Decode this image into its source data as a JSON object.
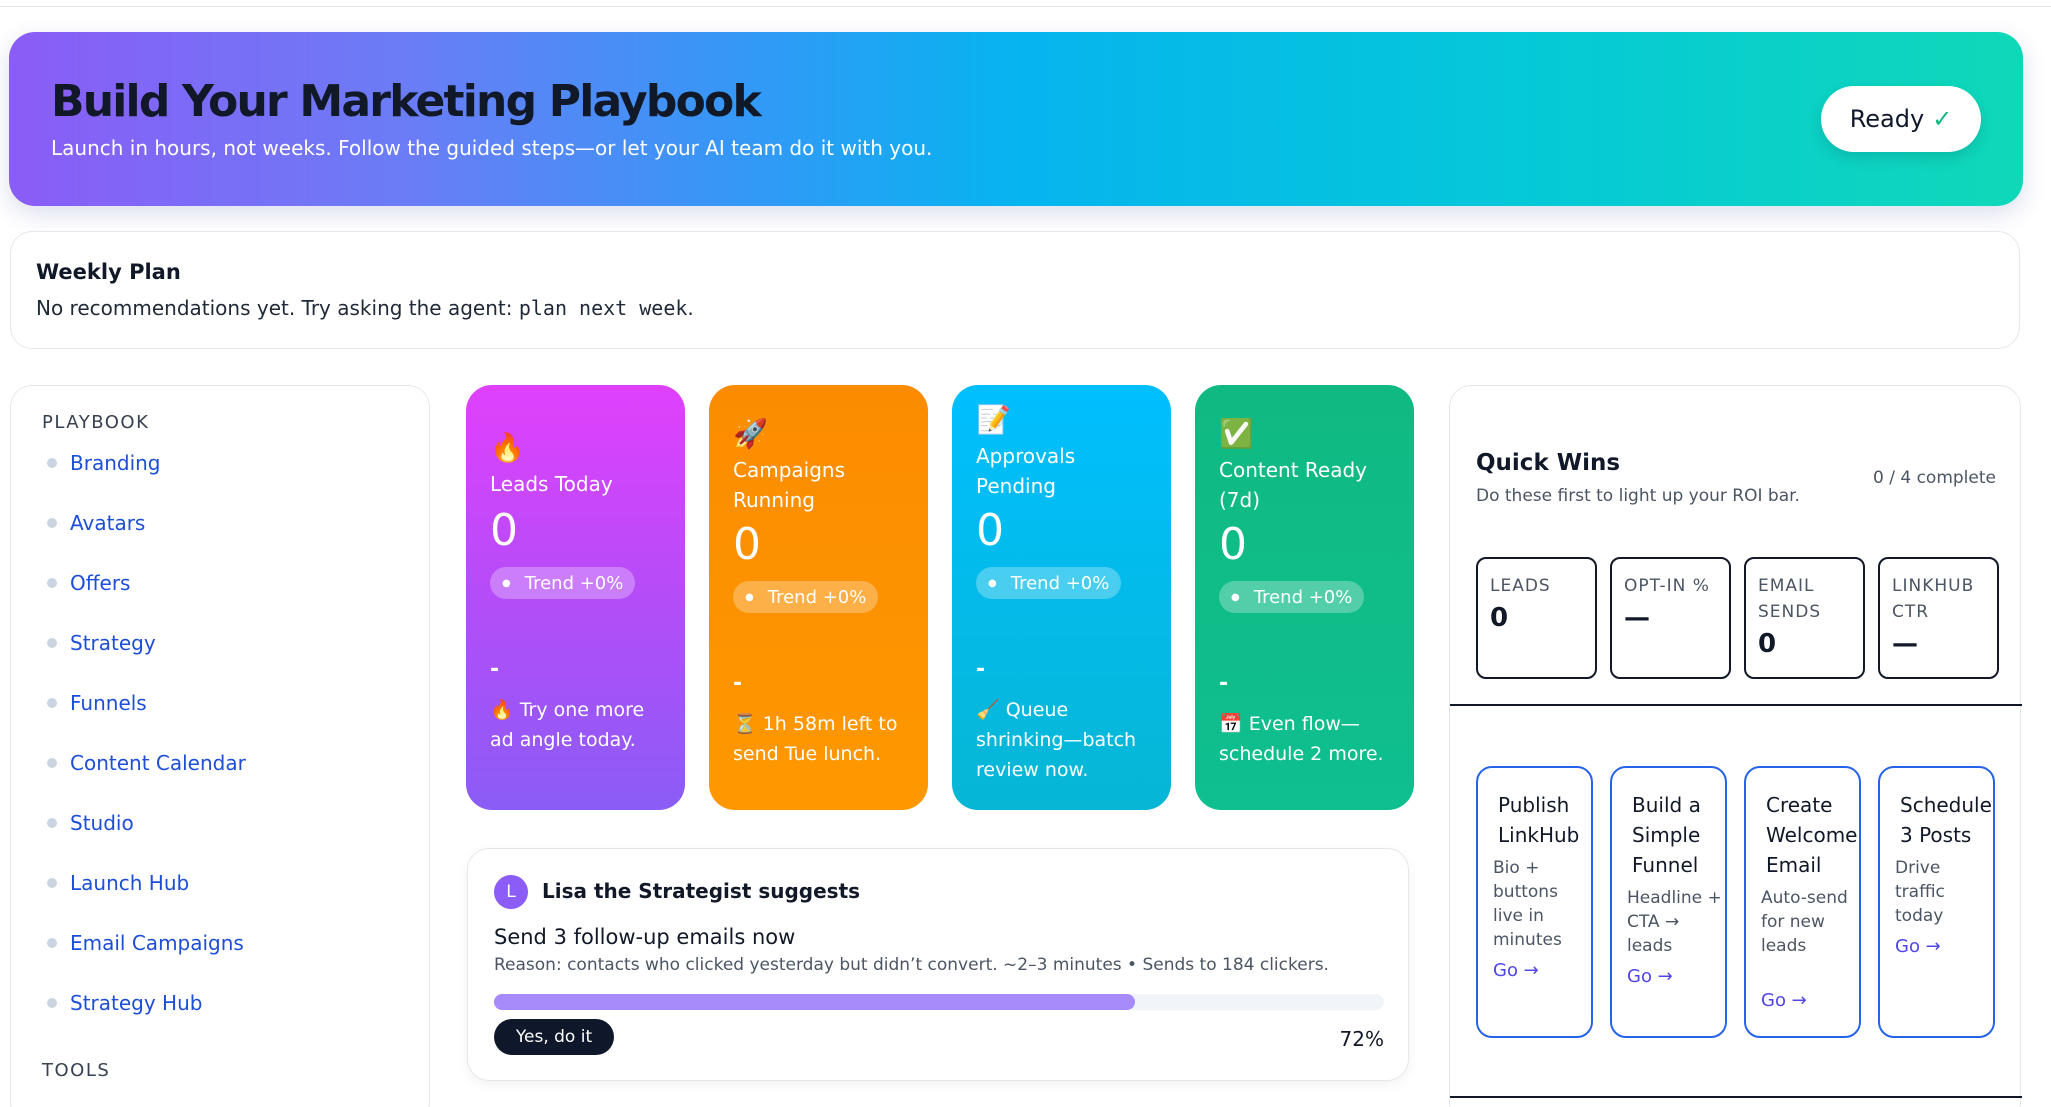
{
  "hero": {
    "title": "Build Your Marketing Playbook",
    "subtitle": "Launch in hours, not weeks. Follow the guided steps—or let your AI team do it with you.",
    "ready_label": "Ready",
    "ready_icon": "✓"
  },
  "weekly_plan": {
    "title": "Weekly Plan",
    "text": "No recommendations yet. Try asking the agent: ",
    "command": "plan next week",
    "period": "."
  },
  "sidebar": {
    "section_playbook": "PLAYBOOK",
    "items": [
      {
        "label": "Branding"
      },
      {
        "label": "Avatars"
      },
      {
        "label": "Offers"
      },
      {
        "label": "Strategy"
      },
      {
        "label": "Funnels"
      },
      {
        "label": "Content Calendar"
      },
      {
        "label": "Studio"
      },
      {
        "label": "Launch Hub"
      },
      {
        "label": "Email Campaigns"
      },
      {
        "label": "Strategy Hub"
      }
    ],
    "section_tools": "TOOLS"
  },
  "stats": [
    {
      "emoji": "🔥",
      "icon": "fire-icon",
      "title": "Leads Today",
      "value": "0",
      "trend": "Trend +0%",
      "dash": "-",
      "tip_emoji": "🔥",
      "tip": "Try one more ad angle today.",
      "color_from": "#e040fb",
      "color_to": "#8b5cf6"
    },
    {
      "emoji": "🚀",
      "icon": "rocket-icon",
      "title": "Campaigns Running",
      "value": "0",
      "trend": "Trend +0%",
      "dash": "-",
      "tip_emoji": "⏳",
      "tip": "1h 58m left to send Tue lunch.",
      "color_from": "#fb8c00",
      "color_to": "#ff9800"
    },
    {
      "emoji": "📝",
      "icon": "memo-icon",
      "title": "Approvals Pending",
      "value": "0",
      "trend": "Trend +0%",
      "dash": "-",
      "tip_emoji": "🧹",
      "tip": "Queue shrinking—batch review now.",
      "color_from": "#0ac2f5",
      "color_to": "#06b6d4"
    },
    {
      "emoji": "✅",
      "icon": "check-icon",
      "title": "Content Ready (7d)",
      "value": "0",
      "trend": "Trend +0%",
      "dash": "-",
      "tip_emoji": "📅",
      "tip": "Even flow—schedule 2 more.",
      "color_from": "#10b981",
      "color_to": "#0fb88a"
    }
  ],
  "suggestion": {
    "avatar_letter": "L",
    "title": "Lisa the Strategist suggests",
    "headline": "Send 3 follow-up emails now",
    "reason": "Reason: contacts who clicked yesterday but didn’t convert. ~2–3 minutes • Sends to 184 clickers.",
    "button": "Yes, do it",
    "progress": 0.72,
    "progress_label": "72%"
  },
  "quick_wins": {
    "title": "Quick Wins",
    "subtitle": "Do these first to light up your ROI bar.",
    "count": "0 / 4 complete",
    "metrics": [
      {
        "label": "LEADS",
        "value": "0"
      },
      {
        "label": "OPT-IN %",
        "value": "—"
      },
      {
        "label": "EMAIL SENDS",
        "value": "0"
      },
      {
        "label": "LINKHUB CTR",
        "value": "—"
      }
    ],
    "actions": [
      {
        "title": "Publish LinkHub",
        "desc": "Bio + buttons live in minutes",
        "go": "Go →"
      },
      {
        "title": "Build a Simple Funnel",
        "desc": "Headline + CTA → leads",
        "go": "Go →"
      },
      {
        "title": "Create Welcome Email",
        "desc": "Auto-send for new leads",
        "go": "Go →"
      },
      {
        "title": "Schedule 3 Posts",
        "desc": "Drive traffic today",
        "go": "Go →"
      }
    ]
  }
}
